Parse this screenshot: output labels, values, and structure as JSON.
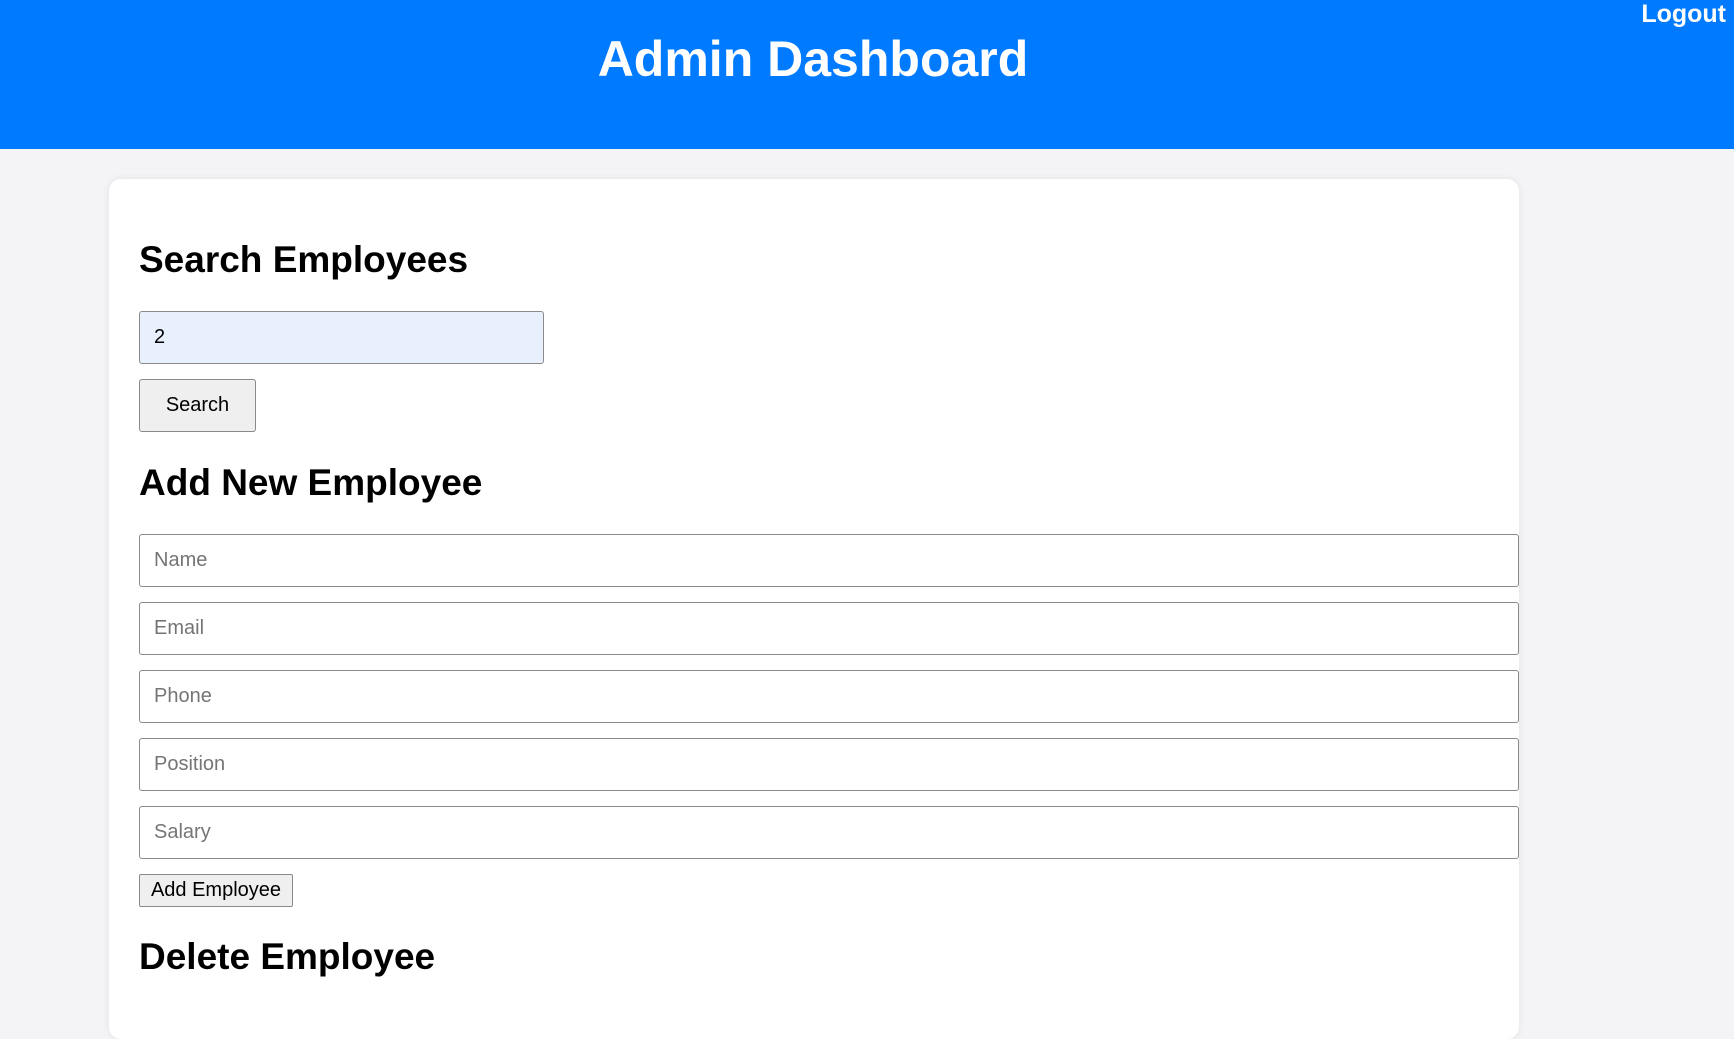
{
  "header": {
    "title": "Admin Dashboard",
    "logout_label": "Logout",
    "background_color": "#007bff"
  },
  "search": {
    "heading": "Search Employees",
    "input_value": "2",
    "button_label": "Search"
  },
  "add_employee": {
    "heading": "Add New Employee",
    "fields": {
      "name_placeholder": "Name",
      "email_placeholder": "Email",
      "phone_placeholder": "Phone",
      "position_placeholder": "Position",
      "salary_placeholder": "Salary"
    },
    "button_label": "Add Employee"
  },
  "delete_employee": {
    "heading": "Delete Employee"
  }
}
